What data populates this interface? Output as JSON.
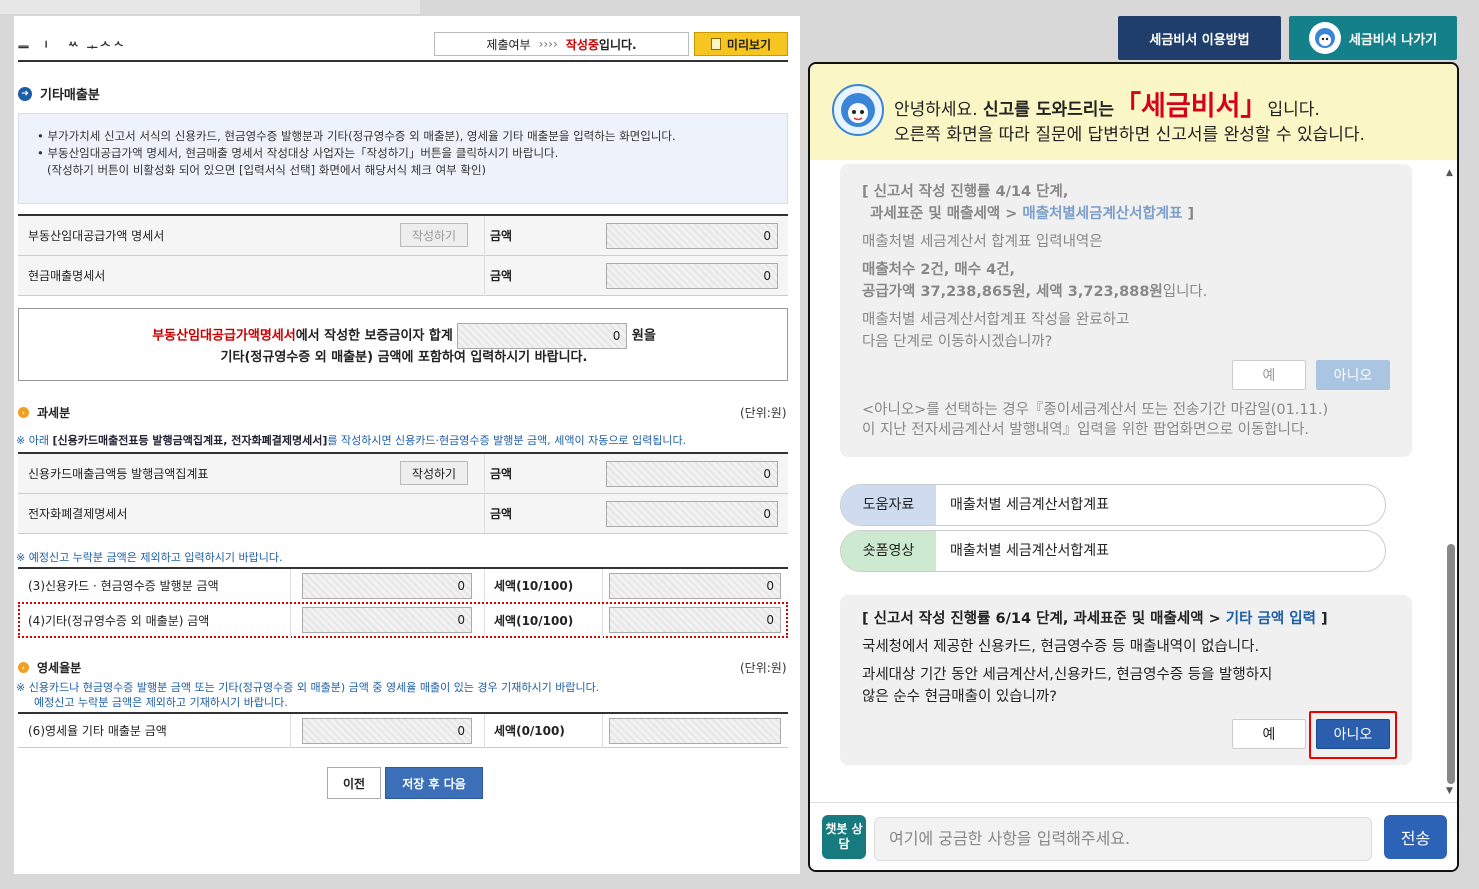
{
  "header": {
    "logo_text": "ᆖ ᆝ ᅠᄿ ᆠᄉᄾ",
    "status_label": "제출여부",
    "status_arrows": "››››",
    "status_value": "작성중",
    "status_suffix": "입니다.",
    "preview_label": "미리보기"
  },
  "other_sales": {
    "title": "기타매출분",
    "info": [
      "• 부가가치세 신고서 서식의 신용카드, 현금영수증 발행분과 기타(정규영수증 외 매출분), 영세율 기타 매출분을 입력하는 화면입니다.",
      "• 부동산임대공급가액 명세서, 현금매출 명세서 작성대상 사업자는「작성하기」버튼을 클릭하시기 바랍니다.",
      "(작성하기 버튼이 비활성화 되어 있으면 [입력서식 선택] 화면에서 해당서식 체크 여부 확인)"
    ],
    "rows": [
      {
        "label": "부동산임대공급가액 명세서",
        "button": "작성하기",
        "amount_label": "금액",
        "amount": "0"
      },
      {
        "label": "현금매출명세서",
        "amount_label": "금액",
        "amount": "0"
      }
    ],
    "notice": {
      "red_part": "부동산임대공급가액명세서",
      "part1": "에서 작성한 보증금이자 합계",
      "value": "0",
      "unit": "원을",
      "line2": "기타(정규영수증 외 매출분) 금액에 포함하여 입력하시기 바랍니다."
    }
  },
  "taxable": {
    "title": "과세분",
    "unit": "(단위:원)",
    "note_prefix": "※ 아래 ",
    "note_bold": "[신용카드매출전표등 발행금액집계표, 전자화폐결제명세서]",
    "note_suffix": "를 작성하시면 신용카드·현금영수증 발행분 금액, 세액이 자동으로 입력됩니다.",
    "rows": [
      {
        "label": "신용카드매출금액등 발행금액집계표",
        "button": "작성하기",
        "amount_label": "금액",
        "amount": "0"
      },
      {
        "label": "전자화폐결제명세서",
        "amount_label": "금액",
        "amount": "0"
      }
    ],
    "note2": "※ 예정신고 누락분 금액은 제외하고 입력하시기 바랍니다.",
    "rows2": [
      {
        "label": "(3)신용카드 · 현금영수증 발행분 금액",
        "amount": "0",
        "tax_label": "세액(10/100)",
        "tax": "0"
      },
      {
        "label": "(4)기타(정규영수증 외 매출분) 금액",
        "amount": "0",
        "tax_label": "세액(10/100)",
        "tax": "0"
      }
    ]
  },
  "zero_rate": {
    "title": "영세율분",
    "unit": "(단위:원)",
    "note1": "※ 신용카드나 현금영수증 발행분 금액 또는 기타(정규영수증 외 매출분) 금액 중 영세율 매출이 있는 경우 기재하시기 바랍니다.",
    "note2": "예정신고 누락분 금액은 제외하고 기재하시기 바랍니다.",
    "row": {
      "label": "(6)영세율 기타 매출분 금액",
      "amount": "0",
      "tax_label": "세액(0/100)",
      "tax": ""
    }
  },
  "nav": {
    "prev": "이전",
    "next": "저장 후 다음"
  },
  "assistant": {
    "guide_button": "세금비서 이용방법",
    "exit_button": "세금비서 나가기",
    "greet_prefix": "안녕하세요. ",
    "greet_bold": "신고를 도와드리는",
    "greet_brand": "「세금비서」",
    "greet_suffix": "입니다.",
    "greet_line2": "오른쪽 화면을 따라 질문에 답변하면 신고서를 완성할 수 있습니다.",
    "msg1": {
      "step_a": "[ 신고서 작성 진행률 4/14 단계,",
      "step_b": "과세표준 및 매출세액 > ",
      "step_link": "매출처별세금계산서합계표",
      "step_end": " ]",
      "l1": "매출처별 세금계산서 합계표 입력내역은",
      "l2": "매출처수 2건, 매수 4건,",
      "l3a": "공급가액 37,238,865원, 세액 3,723,888원",
      "l3b": "입니다.",
      "l4": "매출처별 세금계산서합계표 작성을 완료하고",
      "l5": "다음 단계로 이동하시겠습니까?",
      "yes": "예",
      "no": "아니오",
      "n1": "<아니오>를 선택하는 경우『종이세금계산서 또는 전송기간 마감일(01.11.)",
      "n2": "이 지난 전자세금계산서 발행내역』입력을 위한 팝업화면으로 이동합니다."
    },
    "refs": [
      {
        "tag": "도움자료",
        "name": "매출처별 세금계산서합계표"
      },
      {
        "tag": "숏폼영상",
        "name": "매출처별 세금계산서합계표"
      }
    ],
    "msg2": {
      "step": "[ 신고서 작성 진행률 6/14 단계, 과세표준 및 매출세액 > ",
      "step_link": "기타 금액 입력",
      "step_end": " ]",
      "l1": "국세청에서 제공한 신용카드, 현금영수증 등 매출내역이 없습니다.",
      "l2": "과세대상 기간 동안 세금계산서,신용카드, 현금영수증 등을 발행하지",
      "l3": "않은 순수 현금매출이 있습니까?",
      "yes": "예",
      "no": "아니오"
    },
    "chat_icon": "챗봇 상담",
    "input_placeholder": "여기에 궁금한 사항을 입력해주세요.",
    "send": "전송"
  }
}
